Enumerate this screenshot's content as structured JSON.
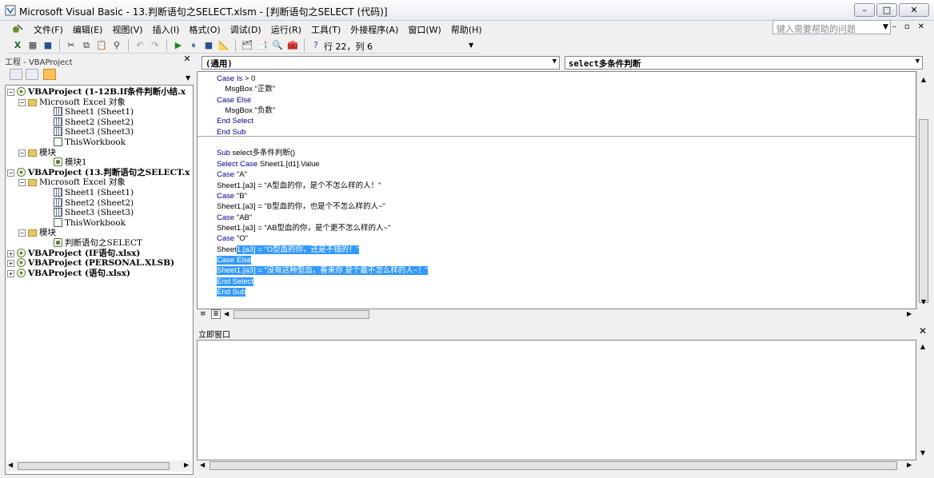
{
  "window": {
    "title": "Microsoft Visual Basic - 13.判断语句之SELECT.xlsm - [判断语句之SELECT (代码)]",
    "minimize": "–",
    "maximize": "□",
    "close": "✕"
  },
  "menubar": {
    "items": [
      "文件(F)",
      "编辑(E)",
      "视图(V)",
      "插入(I)",
      "格式(O)",
      "调试(D)",
      "运行(R)",
      "工具(T)",
      "外接程序(A)",
      "窗口(W)",
      "帮助(H)"
    ],
    "help_search_placeholder": "键入需要帮助的问题",
    "mdi_min": "–",
    "mdi_restore": "▫",
    "mdi_close": "✕"
  },
  "toolbar": {
    "position_status": "行 22，列 6"
  },
  "project_panel": {
    "title": "工程 - VBAProject",
    "close": "✕",
    "tree": [
      {
        "label": "VBAProject (1-12B.If条件判断小结.x",
        "level": 0,
        "bold": true,
        "pm": "−",
        "icon": "proj"
      },
      {
        "label": "Microsoft Excel 对象",
        "level": 1,
        "bold": false,
        "pm": "−",
        "icon": "folder"
      },
      {
        "label": "Sheet1 (Sheet1)",
        "level": 2,
        "bold": false,
        "pm": "",
        "icon": "sheet"
      },
      {
        "label": "Sheet2 (Sheet2)",
        "level": 2,
        "bold": false,
        "pm": "",
        "icon": "sheet"
      },
      {
        "label": "Sheet3 (Sheet3)",
        "level": 2,
        "bold": false,
        "pm": "",
        "icon": "sheet"
      },
      {
        "label": "ThisWorkbook",
        "level": 2,
        "bold": false,
        "pm": "",
        "icon": "wb"
      },
      {
        "label": "模块",
        "level": 1,
        "bold": false,
        "pm": "−",
        "icon": "folder"
      },
      {
        "label": "模块1",
        "level": 2,
        "bold": false,
        "pm": "",
        "icon": "mod"
      },
      {
        "label": "VBAProject (13.判断语句之SELECT.x",
        "level": 0,
        "bold": true,
        "pm": "−",
        "icon": "proj"
      },
      {
        "label": "Microsoft Excel 对象",
        "level": 1,
        "bold": false,
        "pm": "−",
        "icon": "folder"
      },
      {
        "label": "Sheet1 (Sheet1)",
        "level": 2,
        "bold": false,
        "pm": "",
        "icon": "sheet"
      },
      {
        "label": "Sheet2 (Sheet2)",
        "level": 2,
        "bold": false,
        "pm": "",
        "icon": "sheet"
      },
      {
        "label": "Sheet3 (Sheet3)",
        "level": 2,
        "bold": false,
        "pm": "",
        "icon": "sheet"
      },
      {
        "label": "ThisWorkbook",
        "level": 2,
        "bold": false,
        "pm": "",
        "icon": "wb"
      },
      {
        "label": "模块",
        "level": 1,
        "bold": false,
        "pm": "−",
        "icon": "folder"
      },
      {
        "label": "判断语句之SELECT",
        "level": 2,
        "bold": false,
        "pm": "",
        "icon": "mod"
      },
      {
        "label": "VBAProject (IF语句.xlsx)",
        "level": 0,
        "bold": true,
        "pm": "+",
        "icon": "proj"
      },
      {
        "label": "VBAProject (PERSONAL.XLSB)",
        "level": 0,
        "bold": true,
        "pm": "+",
        "icon": "proj"
      },
      {
        "label": "VBAProject (语句.xlsx)",
        "level": 0,
        "bold": true,
        "pm": "+",
        "icon": "proj"
      }
    ]
  },
  "code_window": {
    "object_combo": "(通用)",
    "proc_combo": "select多条件判断",
    "lines": [
      {
        "segs": [
          {
            "t": "Case Is",
            "c": "kw"
          },
          {
            "t": " > 0",
            "c": ""
          }
        ]
      },
      {
        "segs": [
          {
            "t": "    MsgBox \"正数\"",
            "c": ""
          }
        ]
      },
      {
        "segs": [
          {
            "t": "Case Else",
            "c": "kw"
          }
        ]
      },
      {
        "segs": [
          {
            "t": "    MsgBox \"负数\"",
            "c": ""
          }
        ]
      },
      {
        "segs": [
          {
            "t": "End Select",
            "c": "kw"
          }
        ]
      },
      {
        "segs": [
          {
            "t": "End Sub",
            "c": "kw"
          }
        ]
      },
      {
        "segs": []
      },
      {
        "segs": [
          {
            "t": "Sub",
            "c": "kw"
          },
          {
            "t": " select多条件判断()",
            "c": ""
          }
        ]
      },
      {
        "segs": [
          {
            "t": "Select Case",
            "c": "kw"
          },
          {
            "t": " Sheet1.[d1].Value",
            "c": ""
          }
        ]
      },
      {
        "segs": [
          {
            "t": "Case",
            "c": "kw"
          },
          {
            "t": " \"A\"",
            "c": ""
          }
        ]
      },
      {
        "segs": [
          {
            "t": "Sheet1.[a3] = \"A型血的你，是个不怎么样的人！\"",
            "c": ""
          }
        ]
      },
      {
        "segs": [
          {
            "t": "Case",
            "c": "kw"
          },
          {
            "t": " \"B\"",
            "c": ""
          }
        ]
      },
      {
        "segs": [
          {
            "t": "Sheet1.[a3] = \"B型血的你，也是个不怎么样的人~\"",
            "c": ""
          }
        ]
      },
      {
        "segs": [
          {
            "t": "Case",
            "c": "kw"
          },
          {
            "t": " \"AB\"",
            "c": ""
          }
        ]
      },
      {
        "segs": [
          {
            "t": "Sheet1.[a3] = \"AB型血的你，是个更不怎么样的人~\"",
            "c": ""
          }
        ]
      },
      {
        "segs": [
          {
            "t": "Case",
            "c": "kw"
          },
          {
            "t": " \"O\"",
            "c": ""
          }
        ]
      },
      {
        "segs": [
          {
            "t": "Sheet",
            "c": ""
          },
          {
            "t": "1.[a3] = \"O型血的你，还是不错的！\"",
            "c": "sel"
          }
        ]
      },
      {
        "segs": [
          {
            "t": "Case Else",
            "c": "sel"
          }
        ]
      },
      {
        "segs": [
          {
            "t": "Sheet1.[a3] = \"没有这种型血，看来你 是个最不怎么样的人~！\"",
            "c": "sel"
          }
        ]
      },
      {
        "segs": [
          {
            "t": "End Select",
            "c": "sel"
          }
        ]
      },
      {
        "segs": [
          {
            "t": "End Sub",
            "c": "sel"
          }
        ]
      }
    ]
  },
  "immediate_window": {
    "title": "立即窗口",
    "close": "✕"
  },
  "icons": [
    "excel-view-icon",
    "insert-module-icon",
    "save-icon",
    "cut-icon",
    "copy-icon",
    "paste-icon",
    "find-icon",
    "undo-icon",
    "redo-icon",
    "run-icon",
    "break-icon",
    "reset-icon",
    "design-mode-icon",
    "project-explorer-icon",
    "properties-icon",
    "object-browser-icon",
    "toolbox-icon",
    "help-icon"
  ]
}
